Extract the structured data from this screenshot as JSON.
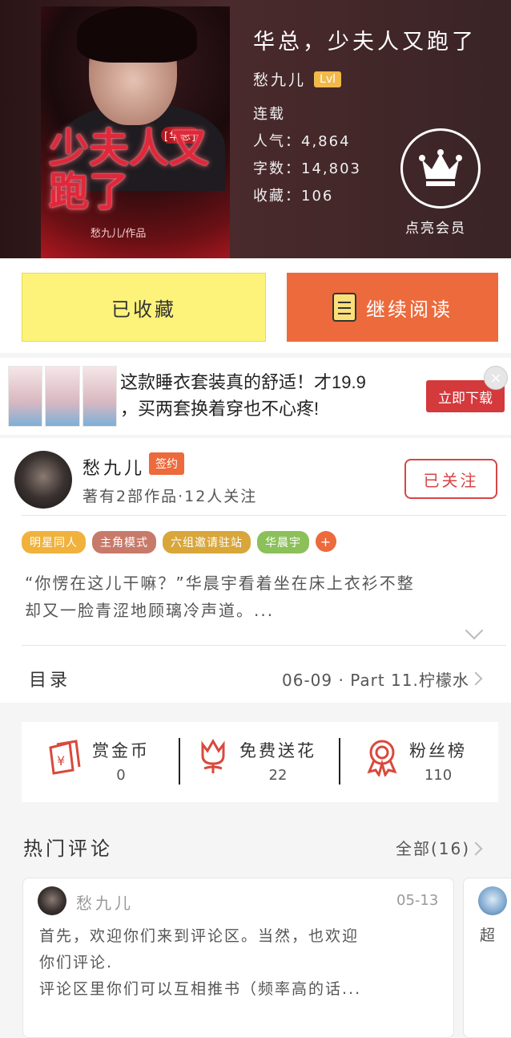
{
  "book": {
    "title": "华总，少夫人又跑了",
    "author": "愁九儿",
    "level": "Lvl",
    "status": "连载",
    "popularity_label": "人气",
    "popularity": "4,864",
    "words_label": "字数",
    "words": "14,803",
    "favorites_label": "收藏",
    "favorites": "106",
    "vip_label": "点亮会员",
    "cover": {
      "tag": "[华总]",
      "art_title": "少夫人又跑了",
      "author_mark": "愁九儿/作品"
    }
  },
  "actions": {
    "favorited_label": "已收藏",
    "continue_label": "继续阅读"
  },
  "ad": {
    "text_line1": "这款睡衣套装真的舒适！才19.9",
    "text_line2": "，买两套换着穿也不心疼!",
    "button_label": "立即下载",
    "close_glyph": "×"
  },
  "author_card": {
    "name": "愁九儿",
    "badge": "签约",
    "stats": "著有2部作品·12人关注",
    "follow_label": "已关注"
  },
  "tags": [
    {
      "label": "明星同人",
      "color": "#f0b23c"
    },
    {
      "label": "主角模式",
      "color": "#c87a6a"
    },
    {
      "label": "六组邀请驻站",
      "color": "#d8a63a"
    },
    {
      "label": "华晨宇",
      "color": "#8cc05a"
    }
  ],
  "tag_more": "+",
  "description": {
    "line1": "“你愣在这儿干嘛？”华晨宇看着坐在床上衣衫不整",
    "line2": "却又一脸青涩地顾璃冷声道。..."
  },
  "toc": {
    "label": "目录",
    "latest": "06-09 · Part 11.柠檬水"
  },
  "stats": [
    {
      "label": "赏金币",
      "value": "0",
      "icon": "red-envelope-icon"
    },
    {
      "label": "免费送花",
      "value": "22",
      "icon": "flower-icon"
    },
    {
      "label": "粉丝榜",
      "value": "110",
      "icon": "medal-icon"
    }
  ],
  "comments": {
    "title": "热门评论",
    "all_label": "全部(16)",
    "items": [
      {
        "author": "愁九儿",
        "date": "05-13",
        "line1": "首先，欢迎你们来到评论区。当然，也欢迎",
        "line2": "你们评论.",
        "line3": "评论区里你们可以互相推书（频率高的话..."
      },
      {
        "body": "超"
      }
    ]
  },
  "colors": {
    "accent": "#ec6a3c",
    "favorite_bg": "#fdf37a",
    "follow_red": "#d64545",
    "level_badge": "#f2b94a"
  }
}
